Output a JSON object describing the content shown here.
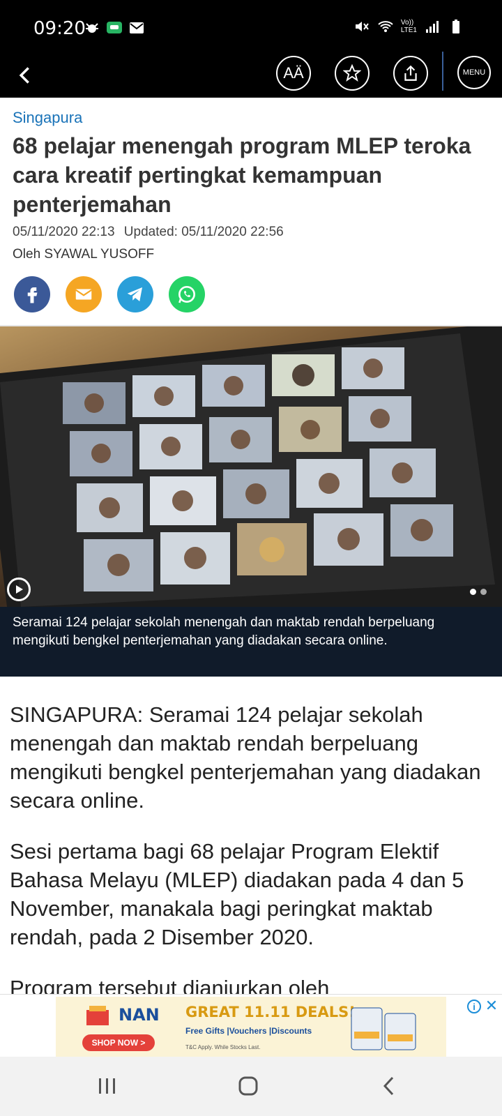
{
  "status_bar": {
    "time": "09:20",
    "network_label_top": "Vo))",
    "network_label_bottom": "LTE1"
  },
  "app_bar": {
    "text_size_label": "AÄ",
    "menu_label": "MENU"
  },
  "article": {
    "section": "Singapura",
    "headline": "68 pelajar menengah program MLEP teroka cara kreatif pertingkat kemampuan penterjemahan",
    "published": "05/11/2020 22:13",
    "updated": "Updated: 05/11/2020 22:56",
    "author": "Oleh SYAWAL YUSOFF",
    "photo_caption": "Seramai 124 pelajar sekolah menengah dan maktab rendah berpeluang mengikuti bengkel penterjemahan yang diadakan secara online.",
    "paragraphs": [
      "SINGAPURA: Seramai 124 pelajar sekolah menengah dan maktab rendah berpeluang mengikuti bengkel penterjemahan yang diadakan secara online.",
      "Sesi pertama bagi 68 pelajar Program Elektif Bahasa Melayu (MLEP) diadakan pada 4 dan 5 November, manakala bagi peringkat maktab rendah, pada 2 Disember 2020.",
      "Program tersebut dianjurkan oleh"
    ]
  },
  "share": {
    "icons": [
      "facebook-icon",
      "email-icon",
      "telegram-icon",
      "whatsapp-icon"
    ]
  },
  "gallery": {
    "slide_count": 2,
    "active_slide": 1
  },
  "ad": {
    "brand": "NAN",
    "headline": "GREAT 11.11 DEALS!",
    "subline": "Free Gifts |Vouchers |Discounts",
    "fine_print": "T&C Apply. While Stocks Last.",
    "cta": "SHOP NOW >",
    "info_label": "i",
    "close_label": "✕"
  },
  "colors": {
    "link": "#1a73b8",
    "caption_bg": "#101b2a",
    "top_bar": "#000000"
  }
}
